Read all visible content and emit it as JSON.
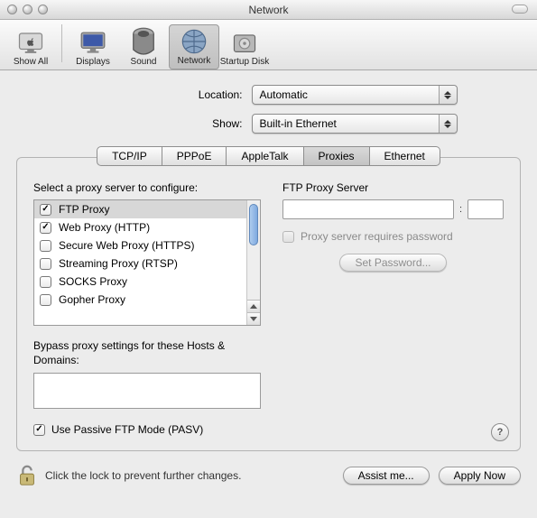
{
  "window": {
    "title": "Network"
  },
  "toolbar": {
    "items": [
      {
        "icon": "apple",
        "label": "Show All"
      },
      {
        "icon": "display",
        "label": "Displays"
      },
      {
        "icon": "speaker",
        "label": "Sound"
      },
      {
        "icon": "globe",
        "label": "Network"
      },
      {
        "icon": "disk",
        "label": "Startup Disk"
      }
    ]
  },
  "form": {
    "location_label": "Location:",
    "location_value": "Automatic",
    "show_label": "Show:",
    "show_value": "Built-in Ethernet"
  },
  "tabs": [
    "TCP/IP",
    "PPPoE",
    "AppleTalk",
    "Proxies",
    "Ethernet"
  ],
  "active_tab": "Proxies",
  "proxies": {
    "select_label": "Select a proxy server to configure:",
    "items": [
      {
        "label": "FTP Proxy",
        "checked": true,
        "selected": true
      },
      {
        "label": "Web Proxy (HTTP)",
        "checked": true,
        "selected": false
      },
      {
        "label": "Secure Web Proxy (HTTPS)",
        "checked": false,
        "selected": false
      },
      {
        "label": "Streaming Proxy (RTSP)",
        "checked": false,
        "selected": false
      },
      {
        "label": "SOCKS Proxy",
        "checked": false,
        "selected": false
      },
      {
        "label": "Gopher Proxy",
        "checked": false,
        "selected": false
      }
    ],
    "bypass_label": "Bypass proxy settings for these Hosts & Domains:",
    "bypass_value": "",
    "pasv_label": "Use Passive FTP Mode (PASV)",
    "pasv_checked": true
  },
  "server": {
    "title": "FTP Proxy Server",
    "host": "",
    "port": "",
    "requires_auth_label": "Proxy server requires password",
    "requires_auth_checked": false,
    "set_password_label": "Set Password..."
  },
  "help_symbol": "?",
  "footer": {
    "lock_text": "Click the lock to prevent further changes.",
    "assist_label": "Assist me...",
    "apply_label": "Apply Now"
  }
}
